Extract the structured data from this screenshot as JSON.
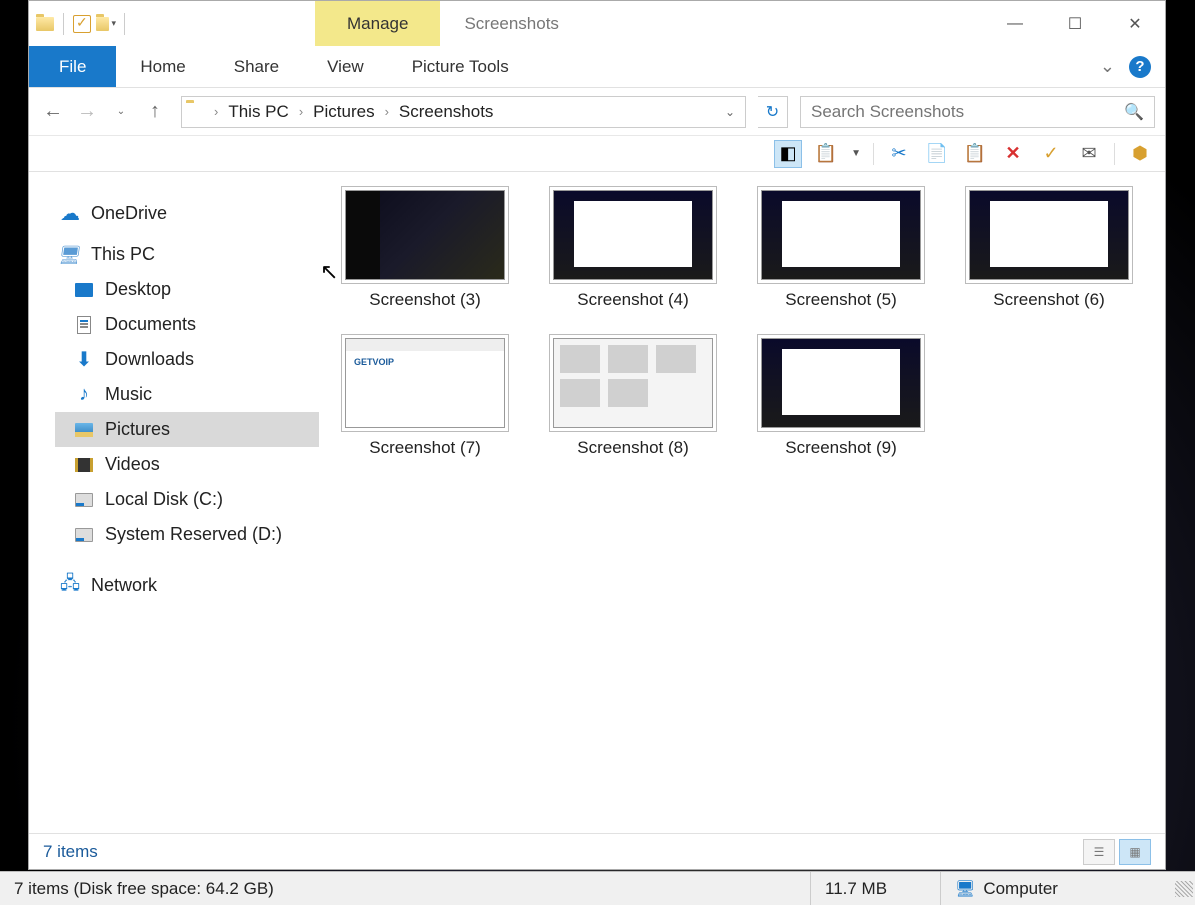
{
  "titlebar": {
    "contextual_tab": "Manage",
    "window_title": "Screenshots"
  },
  "ribbon": {
    "file": "File",
    "tabs": [
      "Home",
      "Share",
      "View"
    ],
    "context_tab": "Picture Tools"
  },
  "breadcrumb": [
    "This PC",
    "Pictures",
    "Screenshots"
  ],
  "search": {
    "placeholder": "Search Screenshots"
  },
  "nav_tree": {
    "onedrive": "OneDrive",
    "thispc": "This PC",
    "children": [
      "Desktop",
      "Documents",
      "Downloads",
      "Music",
      "Pictures",
      "Videos",
      "Local Disk (C:)",
      "System Reserved (D:)"
    ],
    "network": "Network"
  },
  "items": [
    "Screenshot (3)",
    "Screenshot (4)",
    "Screenshot (5)",
    "Screenshot (6)",
    "Screenshot (7)",
    "Screenshot (8)",
    "Screenshot (9)"
  ],
  "status": {
    "summary": "7 items",
    "bottom_main": "7 items (Disk free space: 64.2 GB)",
    "size": "11.7 MB",
    "location": "Computer"
  }
}
